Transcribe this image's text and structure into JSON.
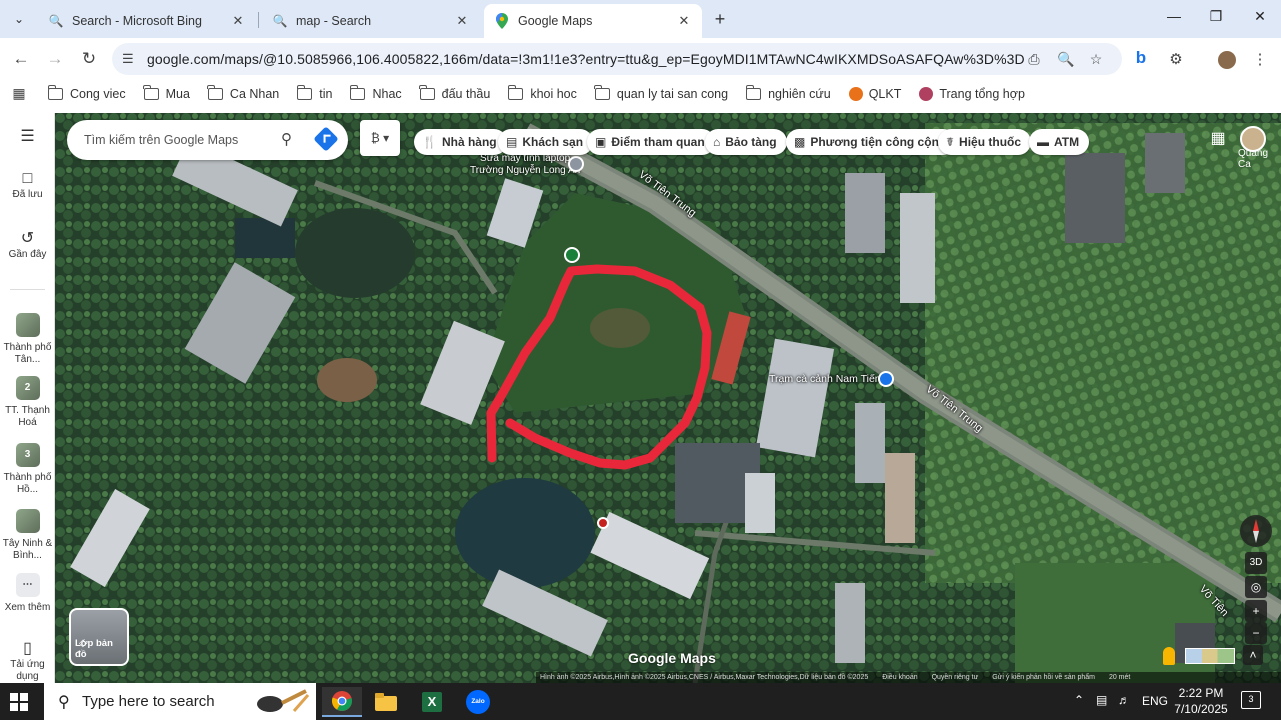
{
  "browser": {
    "tabs": [
      {
        "title": "Search - Microsoft Bing",
        "icon": "search-icon",
        "active": false
      },
      {
        "title": "map - Search",
        "icon": "search-icon",
        "active": false
      },
      {
        "title": "Google Maps",
        "icon": "google-maps-pin-icon",
        "active": true
      }
    ],
    "url": "google.com/maps/@10.5085966,106.4005822,166m/data=!3m1!1e3?entry=ttu&g_ep=EgoyMDI1MTAwNC4wIKXMDSoASAFQAw%3D%3D",
    "bookmarks": [
      "Cong viec",
      "Mua",
      "Ca Nhan",
      "tin",
      "Nhac",
      "đấu thầu",
      "khoi hoc",
      "quan ly tai san cong",
      "nghiên cứu",
      "QLKT",
      "Trang tổng hợp"
    ]
  },
  "maps": {
    "search_placeholder": "Tìm kiếm trên Google Maps",
    "sidebar": [
      {
        "label": "Đã lưu",
        "icon": "bookmark-icon"
      },
      {
        "label": "Gần đây",
        "icon": "history-icon"
      },
      {
        "label": "Thành phố Tân...",
        "badge": ""
      },
      {
        "label": "TT. Thạnh Hoá",
        "badge": "2"
      },
      {
        "label": "Thành phố Hồ...",
        "badge": "3"
      },
      {
        "label": "Tây Ninh & Bình...",
        "badge": ""
      },
      {
        "label": "Xem thêm",
        "icon": "more-icon"
      },
      {
        "label": "Tải ứng dụng",
        "icon": "phone-icon"
      }
    ],
    "chips": [
      {
        "label": "Nhà hàng",
        "icon": "restaurant-icon"
      },
      {
        "label": "Khách sạn",
        "icon": "hotel-icon"
      },
      {
        "label": "Điểm tham quan",
        "icon": "camera-icon"
      },
      {
        "label": "Bảo tàng",
        "icon": "museum-icon"
      },
      {
        "label": "Phương tiện công cộng",
        "icon": "transit-icon"
      },
      {
        "label": "Hiệu thuốc",
        "icon": "pharmacy-icon"
      },
      {
        "label": "ATM",
        "icon": "atm-icon"
      }
    ],
    "account_name": "Quang Ca",
    "labels": {
      "road1": "Võ Tiên Trung",
      "road2": "Võ Tiên Trung",
      "road3": "Võ Tiên",
      "poi_shop": "Sửa máy tính laptop\nTrường Nguyễn Long An",
      "poi_cafe": "Trạm cà cảnh Nam Tiến"
    },
    "layer_label": "Lớp bản đồ",
    "watermark": "Google Maps",
    "attribution": [
      "Hình ảnh ©2025 Airbus,Hình ảnh ©2025 Airbus,CNES / Airbus,Maxar Technologies,Dữ liệu bản đồ ©2025",
      "Điều khoản",
      "Quyền riêng tư",
      "Gửi ý kiến phản hồi về sản phẩm",
      "20 mét"
    ],
    "controls": {
      "view3d": "3D"
    }
  },
  "taskbar": {
    "search_placeholder": "Type here to search",
    "apps": [
      "chrome-icon",
      "file-explorer-icon",
      "excel-icon",
      "zalo-icon"
    ],
    "language": "ENG",
    "time": "2:22 PM",
    "date": "7/10/2025",
    "notification_count": "3",
    "zalo_label": "Zalo",
    "excel_label": "X"
  },
  "colors": {
    "highlight_outline": "#e8283a",
    "accent": "#1a73e8"
  }
}
